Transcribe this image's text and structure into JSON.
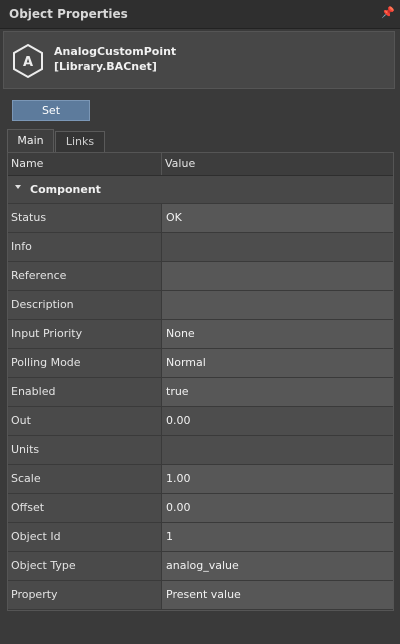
{
  "window": {
    "title": "Object Properties",
    "pin_icon": "pin-icon"
  },
  "object": {
    "icon": "analog-point-icon",
    "icon_letter": "A",
    "name_line1": "AnalogCustomPoint",
    "name_line2": "[Library.BACnet]"
  },
  "toolbar": {
    "set_label": "Set"
  },
  "tabs": [
    {
      "label": "Main",
      "active": true
    },
    {
      "label": "Links",
      "active": false
    }
  ],
  "grid": {
    "columns": {
      "name": "Name",
      "value": "Value"
    },
    "group": {
      "label": "Component",
      "expanded": true
    },
    "rows": [
      {
        "name": "Status",
        "value": "OK"
      },
      {
        "name": "Info",
        "value": ""
      },
      {
        "name": "Reference",
        "value": ""
      },
      {
        "name": "Description",
        "value": ""
      },
      {
        "name": "Input Priority",
        "value": "None"
      },
      {
        "name": "Polling Mode",
        "value": "Normal"
      },
      {
        "name": "Enabled",
        "value": "true"
      },
      {
        "name": "Out",
        "value": "0.00"
      },
      {
        "name": "Units",
        "value": ""
      },
      {
        "name": "Scale",
        "value": "1.00"
      },
      {
        "name": "Offset",
        "value": "0.00"
      },
      {
        "name": "Object Id",
        "value": "1"
      },
      {
        "name": "Object Type",
        "value": "analog_value"
      },
      {
        "name": "Property",
        "value": "Present value"
      }
    ]
  },
  "colors": {
    "background": "#3a3a3a",
    "accent_button": "#5d7b9c"
  }
}
